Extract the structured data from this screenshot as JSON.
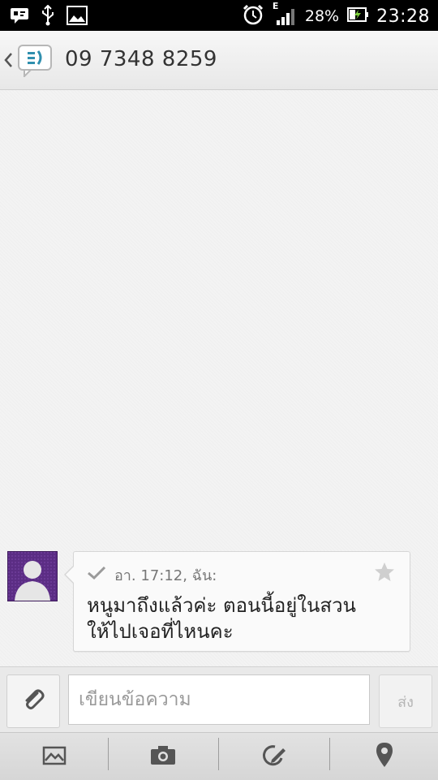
{
  "status_bar": {
    "left_icons": [
      "message-notification-icon",
      "usb-icon",
      "image-notification-icon"
    ],
    "right_icons": [
      "alarm-icon",
      "signal-icon",
      "battery-charging-icon"
    ],
    "network_type": "E",
    "battery_percent": "28%",
    "time": "23:28"
  },
  "header": {
    "back_icon": "chevron-left-icon",
    "app_icon": "messaging-app-icon",
    "title": "09 7348 8259"
  },
  "message": {
    "avatar_icon": "default-contact-avatar-icon",
    "status_icon": "checkmark-icon",
    "meta": "อา. 17:12, ฉัน:",
    "star_icon": "star-icon",
    "line1": "หนูมาถึงแล้วค่ะ ตอนนี้อยู่ในสวน",
    "line2": "ให้ไปเจอที่ไหนคะ"
  },
  "compose": {
    "attach_icon": "paperclip-icon",
    "placeholder": "เขียนข้อความ",
    "send_label": "ส่ง"
  },
  "toolbar": {
    "items": [
      "gallery-icon",
      "camera-icon",
      "sketch-icon",
      "location-pin-icon"
    ]
  },
  "colors": {
    "status_bar": "#000000",
    "header_bg": "#efefef",
    "avatar_bg": "#5b2d84",
    "accent_teal": "#2f8fae"
  }
}
